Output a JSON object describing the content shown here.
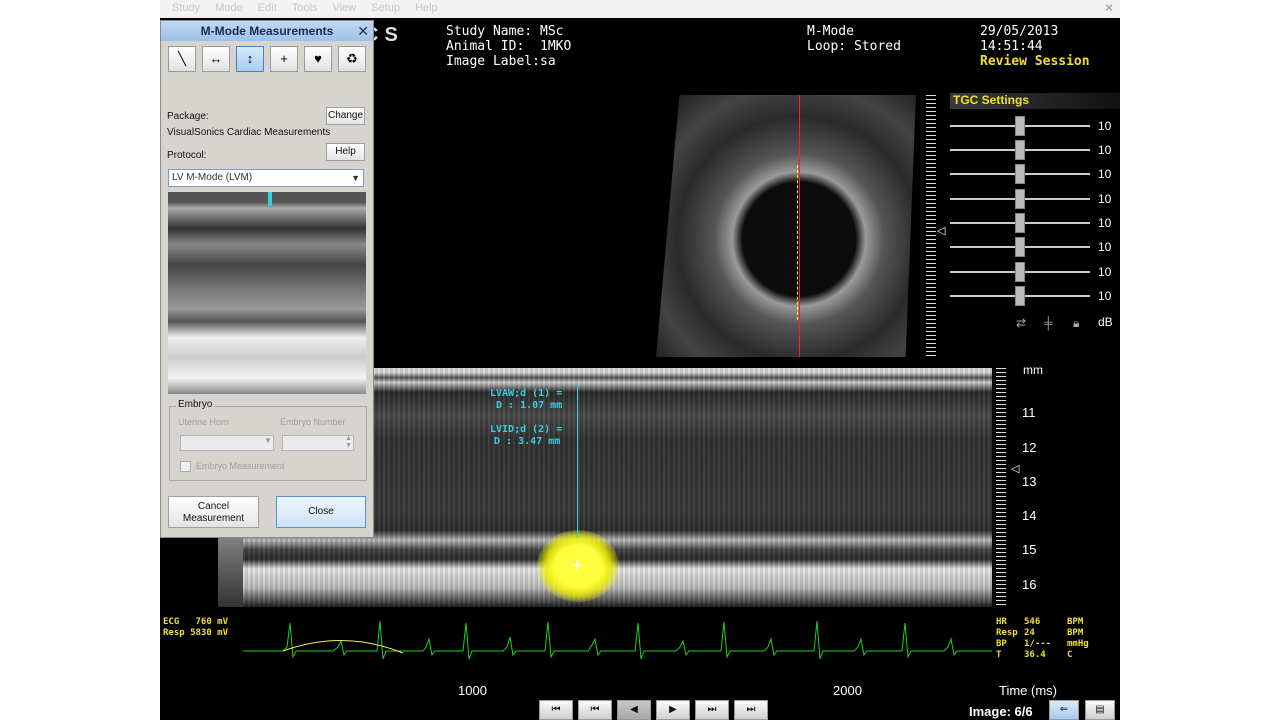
{
  "menu": {
    "items": [
      "Study",
      "Mode",
      "Edit",
      "Tools",
      "View",
      "Setup",
      "Help"
    ]
  },
  "header": {
    "logo_fragment": "CS",
    "study_name_label": "Study Name:",
    "study_name": "MSc",
    "animal_id_label": "Animal ID:",
    "animal_id": "1MKO",
    "image_label_label": "Image Label:",
    "image_label": "sa",
    "mode": "M-Mode",
    "loop": "Loop: Stored",
    "date": "29/05/2013",
    "time": "14:51:44",
    "review": "Review Session"
  },
  "tgc": {
    "title": "TGC Settings",
    "values": [
      "10",
      "10",
      "10",
      "10",
      "10",
      "10",
      "10",
      "10"
    ],
    "unit": "dB",
    "level_fraction": 0.5
  },
  "mmode": {
    "unit": "mm",
    "depth_labels": [
      "11",
      "12",
      "13",
      "14",
      "15",
      "16"
    ],
    "measure1_title": "LVAW;d (1) =",
    "measure1_value": "D : 1.07 mm",
    "measure2_title": "LVID;d (2) =",
    "measure2_value": "D : 3.47 mm"
  },
  "physio": {
    "ecg": "ECG   760 mV",
    "resp": "Resp 5830 mV",
    "hr_label": "HR",
    "hr_value": "546",
    "hr_unit": "BPM",
    "resp_label": "Resp",
    "resp_value": "24",
    "resp_unit": "BPM",
    "bp_label": "BP",
    "bp_value": "1/---",
    "bp_unit": "mmHg",
    "t_label": "T",
    "t_value": "36.4",
    "t_unit": "C"
  },
  "timeline": {
    "ticks": [
      "1000",
      "2000"
    ],
    "axis_label": "Time (ms)",
    "image_counter": "Image: 6/6"
  },
  "playback": {
    "buttons": [
      "⏮",
      "⏮",
      "◀",
      "▶",
      "⏭",
      "⏭"
    ]
  },
  "dialog": {
    "title": "M-Mode Measurements",
    "package_label": "Package:",
    "package_value": "VisualSonics Cardiac Measurements",
    "change_button": "Change",
    "protocol_label": "Protocol:",
    "help_button": "Help",
    "protocol_value": "LV M-Mode (LVM)",
    "embryo_group": "Embryo",
    "uterine_horn_label": "Uterine Horn",
    "embryo_number_label": "Embryo Number",
    "embryo_measurement_label": "Embryo Measurement",
    "cancel_button": "Cancel Measurement",
    "close_button": "Close"
  }
}
